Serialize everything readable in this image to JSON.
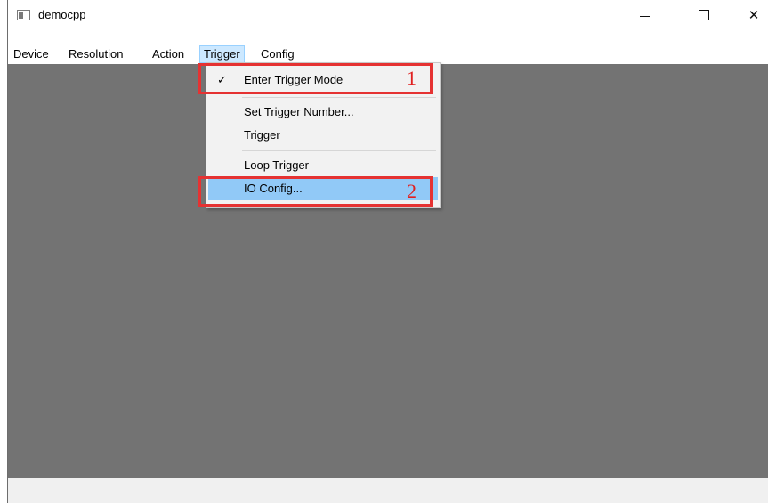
{
  "window": {
    "title": "democpp",
    "minimize_glyph": "—",
    "maximize_glyph": "☐",
    "close_glyph": "✕"
  },
  "menubar": {
    "items": [
      {
        "label": "Device"
      },
      {
        "label": "Resolution"
      },
      {
        "label": "Action"
      },
      {
        "label": "Trigger"
      },
      {
        "label": "Config"
      }
    ]
  },
  "trigger_menu": {
    "items": [
      {
        "label": "Enter Trigger Mode",
        "checked": true,
        "check_glyph": "✓"
      },
      {
        "label": "Set Trigger Number..."
      },
      {
        "label": "Trigger"
      },
      {
        "label": "Loop Trigger"
      },
      {
        "label": "IO Config..."
      }
    ]
  },
  "annotations": {
    "first": "1",
    "second": "2",
    "color": "#e53232"
  },
  "colors": {
    "canvas": "#737373",
    "highlight": "#91c9f7",
    "menu_active": "#cce8ff"
  }
}
